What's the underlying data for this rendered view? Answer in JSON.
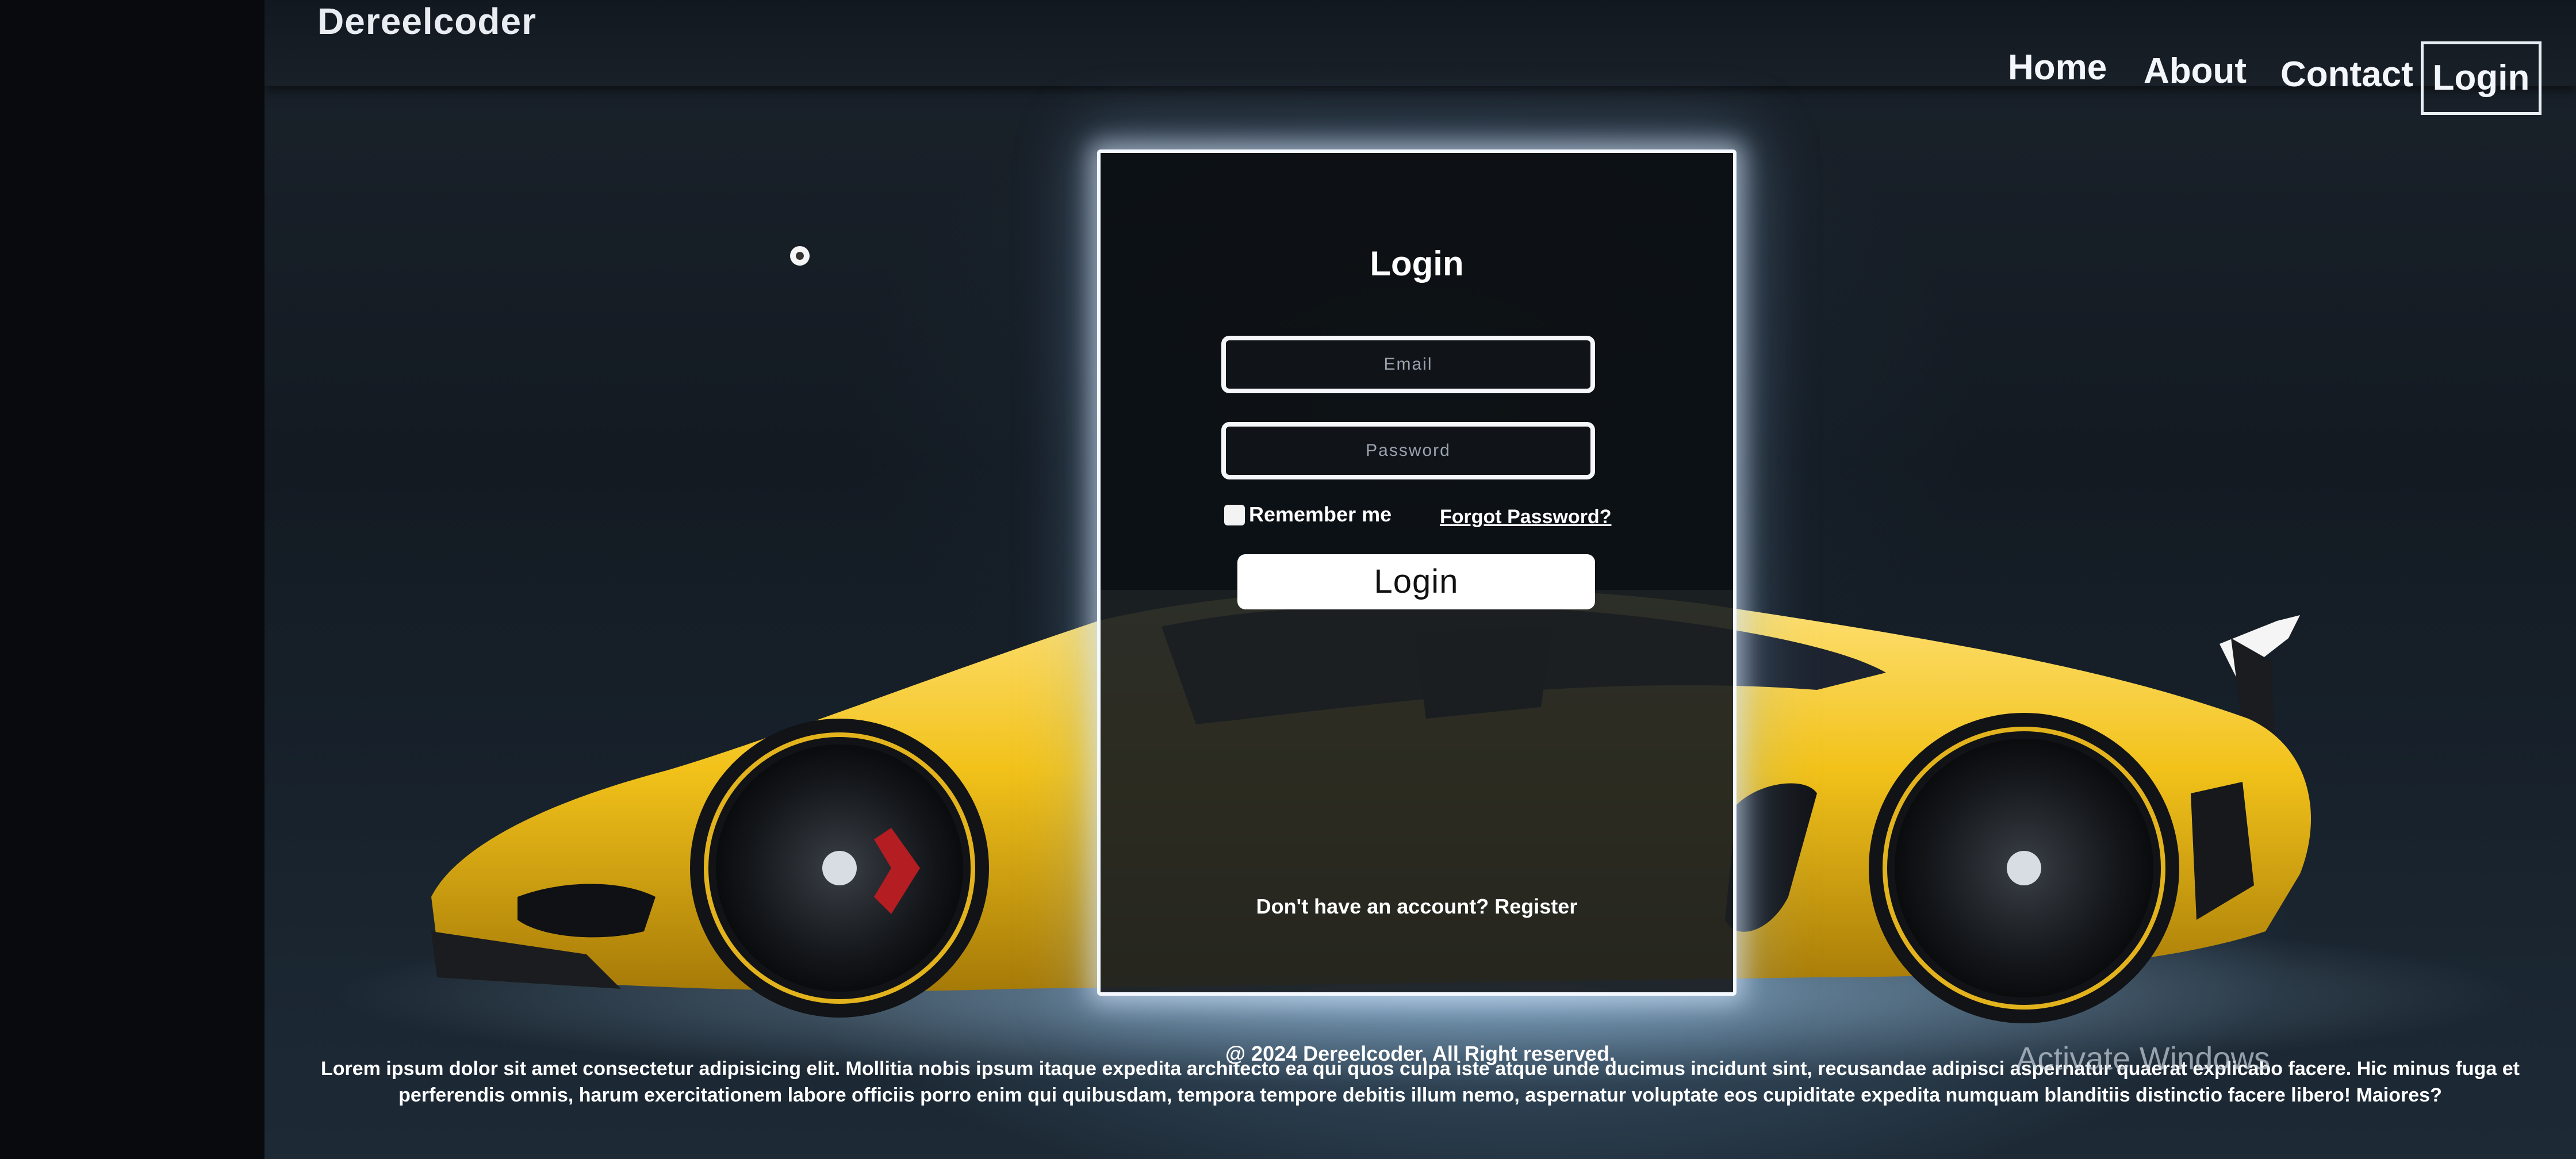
{
  "header": {
    "brand": "Dereelcoder",
    "nav": [
      "Home",
      "About",
      "Contact"
    ],
    "login_label": "Login"
  },
  "login_form": {
    "title": "Login",
    "email_placeholder": "Email",
    "password_placeholder": "Password",
    "remember_label": "Remember me",
    "forgot_label": "Forgot Password?",
    "button_label": "Login",
    "register_line": "Don't have an account? Register"
  },
  "footer": {
    "copyright": "@ 2024 Dereelcoder. All Right reserved.",
    "lorem_line1": "Lorem ipsum dolor sit amet consectetur adipisicing elit. Mollitia nobis ipsum itaque expedita architecto ea qui quos culpa iste atque unde ducimus incidunt sint, recusandae adipisci aspernatur quaerat explicabo facere. Hic minus fuga et",
    "lorem_line2": "perferendis omnis, harum exercitationem labore officiis porro enim qui quibusdam, tempora tempore debitis illum nemo, aspernatur voluptate eos cupiditate expedita numquam blanditiis distinctio facere libero! Maiores?"
  },
  "overlay": {
    "activate_windows": "Activate Windows"
  },
  "colors": {
    "car_yellow": "#f2c21a",
    "panel_glow": "#f4f8ff",
    "background": "#131a22"
  }
}
